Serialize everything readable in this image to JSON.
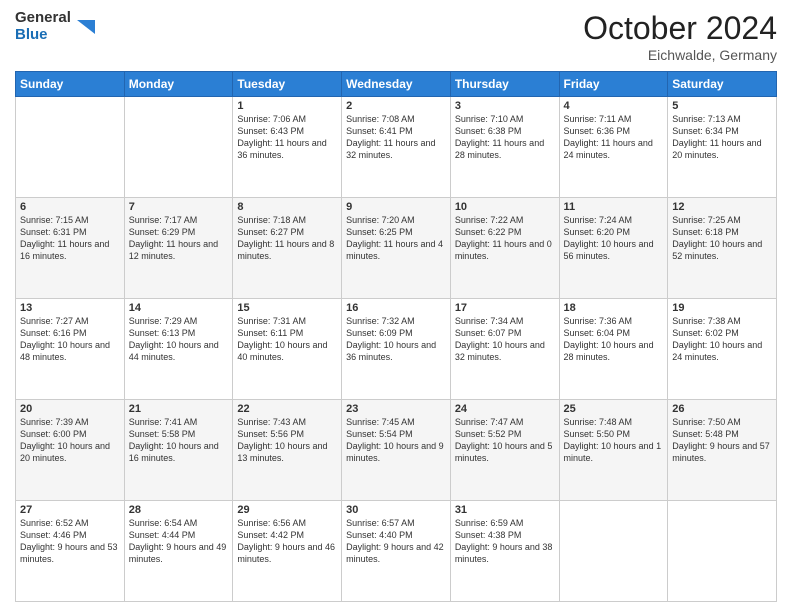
{
  "header": {
    "logo_line1": "General",
    "logo_line2": "Blue",
    "month": "October 2024",
    "location": "Eichwalde, Germany"
  },
  "weekdays": [
    "Sunday",
    "Monday",
    "Tuesday",
    "Wednesday",
    "Thursday",
    "Friday",
    "Saturday"
  ],
  "weeks": [
    [
      {
        "day": "",
        "info": ""
      },
      {
        "day": "",
        "info": ""
      },
      {
        "day": "1",
        "info": "Sunrise: 7:06 AM\nSunset: 6:43 PM\nDaylight: 11 hours and 36 minutes."
      },
      {
        "day": "2",
        "info": "Sunrise: 7:08 AM\nSunset: 6:41 PM\nDaylight: 11 hours and 32 minutes."
      },
      {
        "day": "3",
        "info": "Sunrise: 7:10 AM\nSunset: 6:38 PM\nDaylight: 11 hours and 28 minutes."
      },
      {
        "day": "4",
        "info": "Sunrise: 7:11 AM\nSunset: 6:36 PM\nDaylight: 11 hours and 24 minutes."
      },
      {
        "day": "5",
        "info": "Sunrise: 7:13 AM\nSunset: 6:34 PM\nDaylight: 11 hours and 20 minutes."
      }
    ],
    [
      {
        "day": "6",
        "info": "Sunrise: 7:15 AM\nSunset: 6:31 PM\nDaylight: 11 hours and 16 minutes."
      },
      {
        "day": "7",
        "info": "Sunrise: 7:17 AM\nSunset: 6:29 PM\nDaylight: 11 hours and 12 minutes."
      },
      {
        "day": "8",
        "info": "Sunrise: 7:18 AM\nSunset: 6:27 PM\nDaylight: 11 hours and 8 minutes."
      },
      {
        "day": "9",
        "info": "Sunrise: 7:20 AM\nSunset: 6:25 PM\nDaylight: 11 hours and 4 minutes."
      },
      {
        "day": "10",
        "info": "Sunrise: 7:22 AM\nSunset: 6:22 PM\nDaylight: 11 hours and 0 minutes."
      },
      {
        "day": "11",
        "info": "Sunrise: 7:24 AM\nSunset: 6:20 PM\nDaylight: 10 hours and 56 minutes."
      },
      {
        "day": "12",
        "info": "Sunrise: 7:25 AM\nSunset: 6:18 PM\nDaylight: 10 hours and 52 minutes."
      }
    ],
    [
      {
        "day": "13",
        "info": "Sunrise: 7:27 AM\nSunset: 6:16 PM\nDaylight: 10 hours and 48 minutes."
      },
      {
        "day": "14",
        "info": "Sunrise: 7:29 AM\nSunset: 6:13 PM\nDaylight: 10 hours and 44 minutes."
      },
      {
        "day": "15",
        "info": "Sunrise: 7:31 AM\nSunset: 6:11 PM\nDaylight: 10 hours and 40 minutes."
      },
      {
        "day": "16",
        "info": "Sunrise: 7:32 AM\nSunset: 6:09 PM\nDaylight: 10 hours and 36 minutes."
      },
      {
        "day": "17",
        "info": "Sunrise: 7:34 AM\nSunset: 6:07 PM\nDaylight: 10 hours and 32 minutes."
      },
      {
        "day": "18",
        "info": "Sunrise: 7:36 AM\nSunset: 6:04 PM\nDaylight: 10 hours and 28 minutes."
      },
      {
        "day": "19",
        "info": "Sunrise: 7:38 AM\nSunset: 6:02 PM\nDaylight: 10 hours and 24 minutes."
      }
    ],
    [
      {
        "day": "20",
        "info": "Sunrise: 7:39 AM\nSunset: 6:00 PM\nDaylight: 10 hours and 20 minutes."
      },
      {
        "day": "21",
        "info": "Sunrise: 7:41 AM\nSunset: 5:58 PM\nDaylight: 10 hours and 16 minutes."
      },
      {
        "day": "22",
        "info": "Sunrise: 7:43 AM\nSunset: 5:56 PM\nDaylight: 10 hours and 13 minutes."
      },
      {
        "day": "23",
        "info": "Sunrise: 7:45 AM\nSunset: 5:54 PM\nDaylight: 10 hours and 9 minutes."
      },
      {
        "day": "24",
        "info": "Sunrise: 7:47 AM\nSunset: 5:52 PM\nDaylight: 10 hours and 5 minutes."
      },
      {
        "day": "25",
        "info": "Sunrise: 7:48 AM\nSunset: 5:50 PM\nDaylight: 10 hours and 1 minute."
      },
      {
        "day": "26",
        "info": "Sunrise: 7:50 AM\nSunset: 5:48 PM\nDaylight: 9 hours and 57 minutes."
      }
    ],
    [
      {
        "day": "27",
        "info": "Sunrise: 6:52 AM\nSunset: 4:46 PM\nDaylight: 9 hours and 53 minutes."
      },
      {
        "day": "28",
        "info": "Sunrise: 6:54 AM\nSunset: 4:44 PM\nDaylight: 9 hours and 49 minutes."
      },
      {
        "day": "29",
        "info": "Sunrise: 6:56 AM\nSunset: 4:42 PM\nDaylight: 9 hours and 46 minutes."
      },
      {
        "day": "30",
        "info": "Sunrise: 6:57 AM\nSunset: 4:40 PM\nDaylight: 9 hours and 42 minutes."
      },
      {
        "day": "31",
        "info": "Sunrise: 6:59 AM\nSunset: 4:38 PM\nDaylight: 9 hours and 38 minutes."
      },
      {
        "day": "",
        "info": ""
      },
      {
        "day": "",
        "info": ""
      }
    ]
  ]
}
